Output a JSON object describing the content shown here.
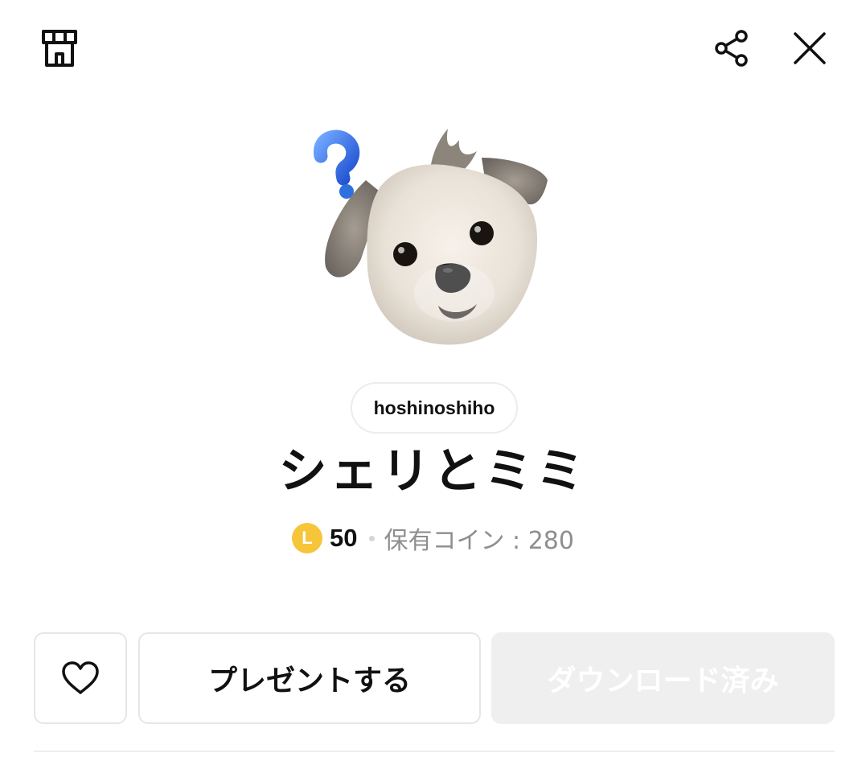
{
  "header": {
    "shop_icon": "shop-icon",
    "share_icon": "share-icon",
    "close_icon": "close-icon"
  },
  "sticker": {
    "image": "dog-head-with-question-mark"
  },
  "author": {
    "name": "hoshinoshiho"
  },
  "product": {
    "title": "シェリとミミ",
    "coin_symbol": "L",
    "price": "50",
    "owned_coins": "保有コイン : 280"
  },
  "actions": {
    "like_icon": "heart-icon",
    "present_label": "プレゼントする",
    "download_label": "ダウンロード済み"
  },
  "colors": {
    "coin": "#f7c53a",
    "question_mark": "#2f6fe0",
    "disabled_button": "#efefef",
    "muted_text": "#8e8e8e"
  }
}
